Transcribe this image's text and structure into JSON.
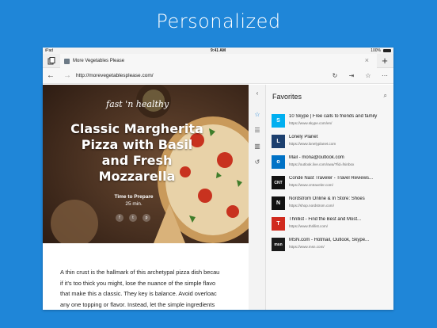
{
  "headline": "Personalized",
  "status": {
    "device": "iPad",
    "time": "9:41 AM",
    "battery": "100%"
  },
  "tab": {
    "title": "More Vegetables Please"
  },
  "address": {
    "url": "http://morevegetablesplease.com/"
  },
  "hero": {
    "tagline": "fast 'n healthy",
    "dish_line1": "Classic Margherita",
    "dish_line2": "Pizza with Basil",
    "dish_line3": "and Fresh",
    "dish_line4": "Mozzarella",
    "prep_label": "Time to Prepare",
    "prep_time": "25 min."
  },
  "article": {
    "line1": "A thin crust is the hallmark of this archetypal pizza dish becau",
    "line2": "if it's too thick you might, lose the nuance of the simple flavo",
    "line3": "that make this a classic. They key is balance. Avoid overloac",
    "line4": "any one topping or flavor. Instead, let the simple ingredients"
  },
  "favorites": {
    "title": "Favorites",
    "items": [
      {
        "name": "10 Skype | Free calls to friends and family",
        "url": "https://www.skype.com/en/"
      },
      {
        "name": "Lonely Planet",
        "url": "https://www.lonelyplanet.com"
      },
      {
        "name": "Mail - mona@outlook.com",
        "url": "https://outlook.live.com/owa/?fid=fsinbox"
      },
      {
        "name": "Condé Nast Traveler - Travel Reviews...",
        "url": "https://www.cntraveler.com/"
      },
      {
        "name": "Nordstrom Online & In Store: Shoes",
        "url": "https://shop.nordstrom.com/"
      },
      {
        "name": "Thrillist - Find the Best and Most...",
        "url": "https://www.thrillist.com/"
      },
      {
        "name": "MSN.com - Hotmail, Outlook, Skype...",
        "url": "https://www.msn.com/"
      }
    ],
    "logos": [
      "S",
      "L",
      "o",
      "CNT",
      "N",
      "T",
      "msn"
    ]
  },
  "colors": {
    "background": "#1f86d8",
    "accent": "#1f86d8"
  }
}
